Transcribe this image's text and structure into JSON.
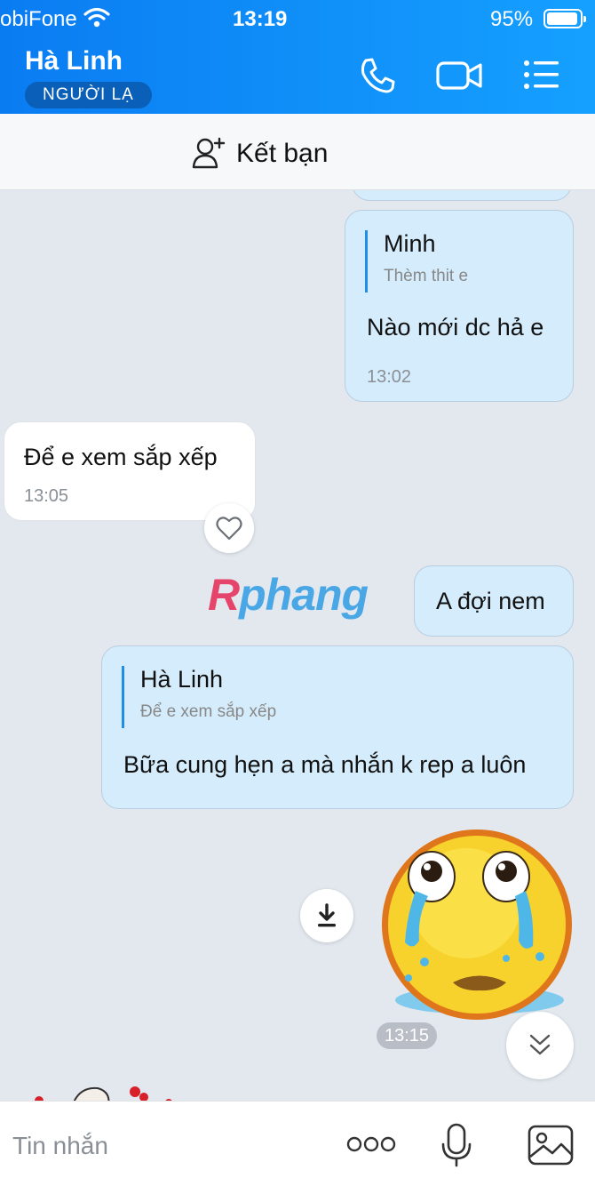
{
  "status_bar": {
    "carrier": "obiFone",
    "time": "13:19",
    "battery_percent": "95%",
    "battery_level": 0.95
  },
  "header": {
    "contact_name": "Hà Linh",
    "badge": "NGƯỜI LẠ",
    "icons": [
      "phone-icon",
      "video-call-icon",
      "menu-list-icon"
    ]
  },
  "add_friend": {
    "label": "Kết bạn",
    "icon": "add-user-icon"
  },
  "messages": [
    {
      "side": "mine",
      "quote_author": "Minh",
      "quote_text": "Thèm thit e",
      "text": "Nào mới dc hả e",
      "time": "13:02"
    },
    {
      "side": "theirs",
      "text": "Để e xem sắp xếp",
      "time": "13:05",
      "reaction_icon": "heart-icon"
    },
    {
      "side": "mine",
      "text": "A đợi nem"
    },
    {
      "side": "mine",
      "quote_author": "Hà Linh",
      "quote_text": "Để e xem sắp xếp",
      "text": "Bữa cung hẹn a mà nhắn k rep a luôn"
    },
    {
      "side": "mine",
      "type": "sticker",
      "sticker": "crying-face-sticker",
      "time": "13:15"
    }
  ],
  "watermark": {
    "first": "R",
    "rest": "phang"
  },
  "input_bar": {
    "placeholder": "Tin nhắn",
    "icons": [
      "more-options-icon",
      "microphone-icon",
      "image-icon"
    ]
  },
  "colors": {
    "header_gradient_start": "#0a7cf2",
    "header_gradient_end": "#15a0ff",
    "mine_bubble": "#d4ecfb",
    "theirs_bubble": "#ffffff",
    "quote_bar": "#1f8fe5",
    "chat_background": "#e3e8ef"
  }
}
